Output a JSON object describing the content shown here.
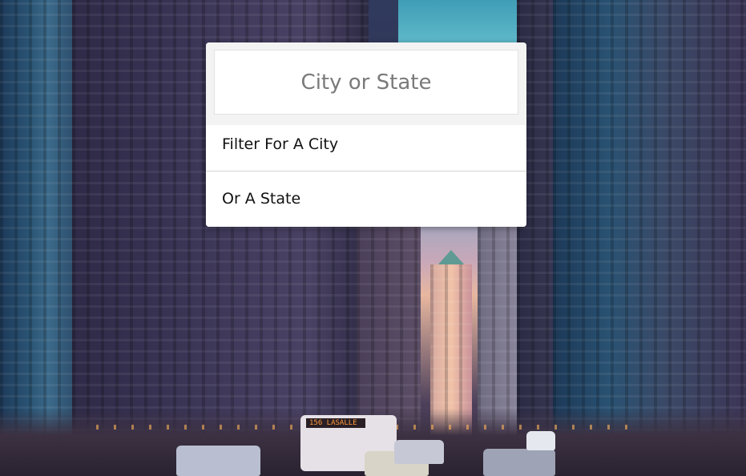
{
  "search": {
    "placeholder": "City or State",
    "value": ""
  },
  "suggestions": [
    {
      "label": "Filter For A City"
    },
    {
      "label": "Or A State"
    }
  ],
  "background": {
    "bus_sign": "156 LASALLE"
  },
  "colors": {
    "panel_bg": "#ffffff",
    "input_bg": "#f3f3f3",
    "text": "#111111",
    "placeholder": "#7a7a7a"
  }
}
